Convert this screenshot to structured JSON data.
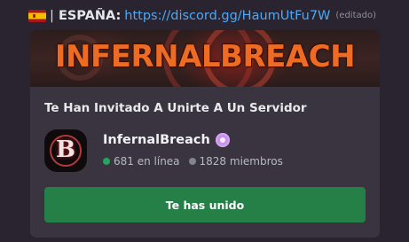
{
  "message": {
    "flag_icon": "spain-flag-icon",
    "prefix": "ESPAÑA",
    "pipe": "|",
    "colon": ":",
    "link": "https://discord.gg/HaumUtFu7W",
    "edited": "(editado)"
  },
  "invite": {
    "banner_text": "INFERNALBREACH",
    "heading": "Te Han Invitado A Unirte A Un Servidor",
    "server_icon_letter": "B",
    "server_name": "InfernalBreach",
    "badge_icon": "partner-badge-icon",
    "online_text": "681 en línea",
    "members_text": "1828 miembros",
    "button_label": "Te has unido"
  },
  "colors": {
    "background": "#2a2431",
    "card": "#3a3440",
    "link": "#4ea8f5",
    "button": "#248046",
    "online": "#23a55a",
    "banner_text": "#ee6b24"
  }
}
